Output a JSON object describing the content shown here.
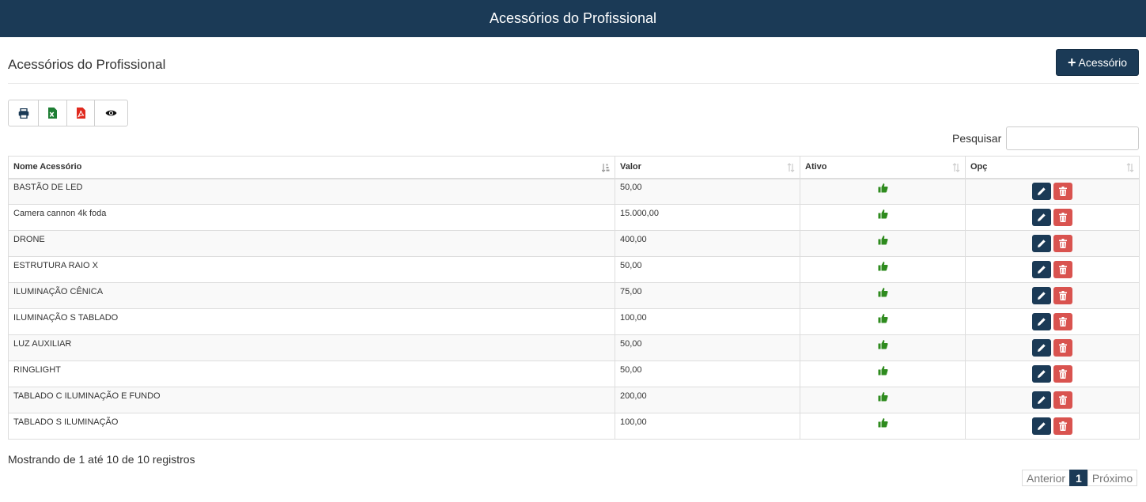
{
  "header": {
    "title": "Acessórios do Profissional"
  },
  "page": {
    "title": "Acessórios do Profissional",
    "add_button_label": "Acessório"
  },
  "toolbar": {
    "icons": [
      "print-icon",
      "excel-icon",
      "pdf-icon",
      "eye-icon"
    ]
  },
  "search": {
    "label": "Pesquisar",
    "value": ""
  },
  "table": {
    "columns": [
      "Nome Acessório",
      "Valor",
      "Ativo",
      "Opç"
    ],
    "rows": [
      {
        "name": "BASTÃO DE LED",
        "value": "50,00"
      },
      {
        "name": "Camera cannon 4k foda",
        "value": "15.000,00"
      },
      {
        "name": "DRONE",
        "value": "400,00"
      },
      {
        "name": "ESTRUTURA RAIO X",
        "value": "50,00"
      },
      {
        "name": "ILUMINAÇÃO CÊNICA",
        "value": "75,00"
      },
      {
        "name": "ILUMINAÇÃO S TABLADO",
        "value": "100,00"
      },
      {
        "name": "LUZ AUXILIAR",
        "value": "50,00"
      },
      {
        "name": "RINGLIGHT",
        "value": "50,00"
      },
      {
        "name": "TABLADO C ILUMINAÇÃO E FUNDO",
        "value": "200,00"
      },
      {
        "name": "TABLADO S ILUMINAÇÃO",
        "value": "100,00"
      }
    ]
  },
  "footer": {
    "info": "Mostrando de 1 até 10 de 10 registros",
    "prev": "Anterior",
    "page": "1",
    "next": "Próximo"
  },
  "colors": {
    "primary": "#1b3a56",
    "danger": "#d9534f",
    "success": "#2e8b1e"
  }
}
